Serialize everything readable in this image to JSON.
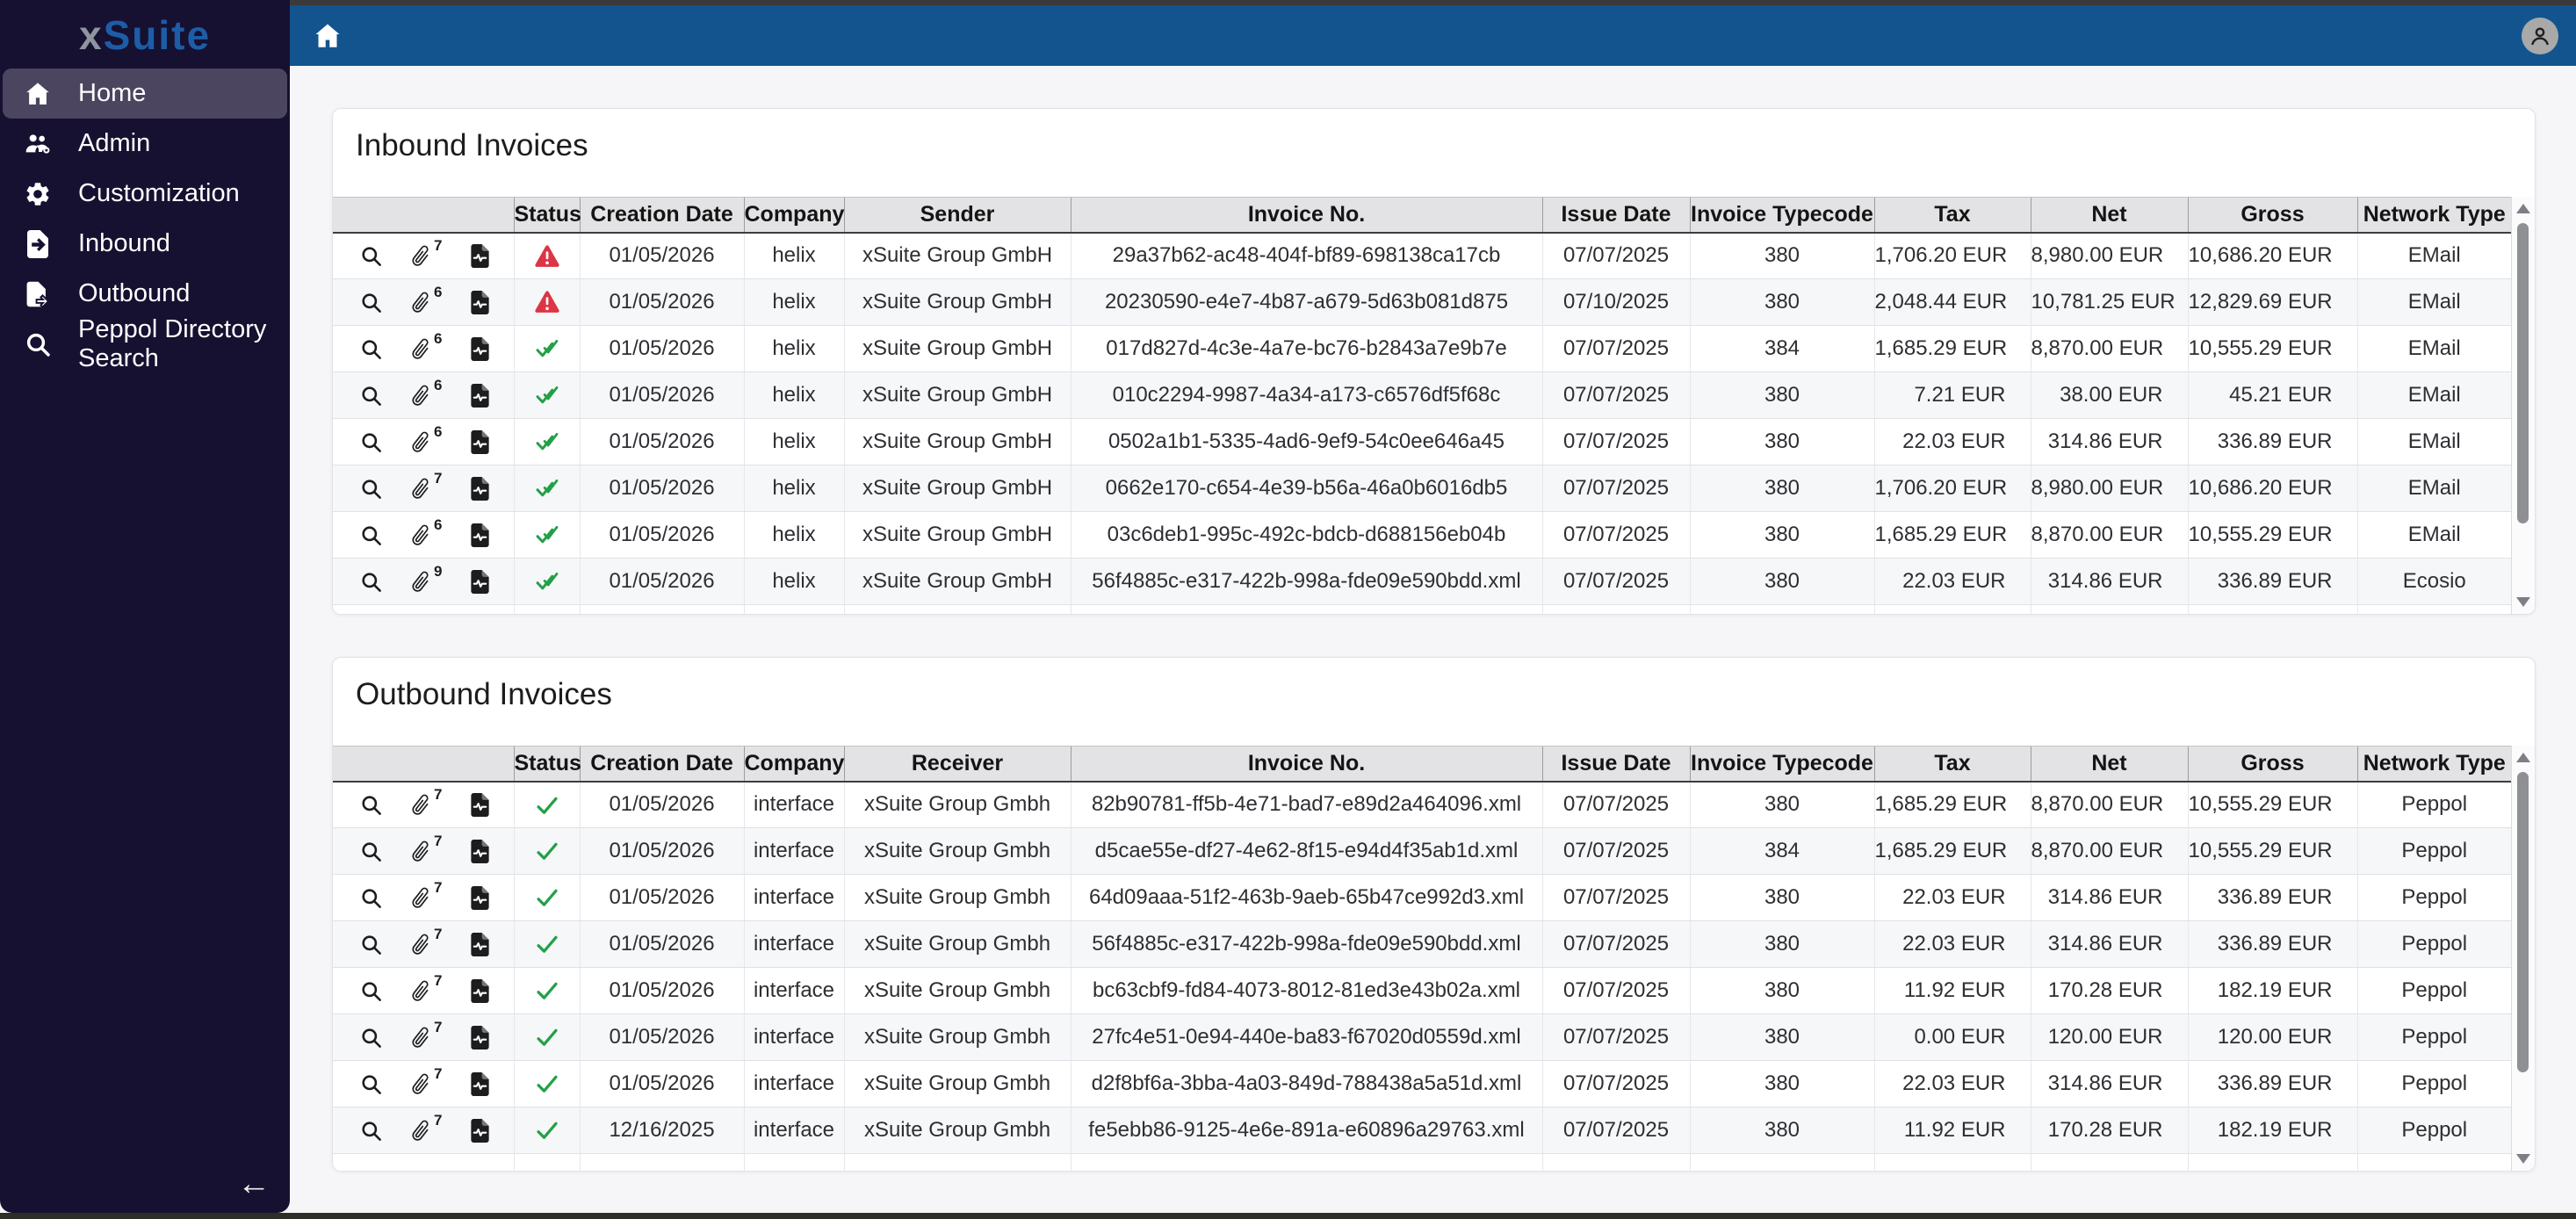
{
  "app": {
    "name": "xSuite"
  },
  "sidebar": {
    "logo": {
      "prefix": "x",
      "rest": "Suite"
    },
    "items": [
      {
        "label": "Home",
        "icon": "home-icon",
        "active": true
      },
      {
        "label": "Admin",
        "icon": "admin-users-icon",
        "active": false
      },
      {
        "label": "Customization",
        "icon": "gear-icon",
        "active": false
      },
      {
        "label": "Inbound",
        "icon": "inbound-document-icon",
        "active": false
      },
      {
        "label": "Outbound",
        "icon": "outbound-document-icon",
        "active": false
      },
      {
        "label": "Peppol Directory Search",
        "icon": "search-icon",
        "active": false
      }
    ],
    "collapse_arrow": "←"
  },
  "topbar": {
    "home_icon": "home-icon",
    "avatar_icon": "user-icon"
  },
  "icons": {
    "row_actions": [
      "search-icon",
      "paperclip-icon",
      "document-pulse-icon"
    ],
    "status": {
      "error": "warning-triangle-icon",
      "success": "check-icon",
      "success_double": "double-check-icon"
    }
  },
  "colors": {
    "topbar_blue": "#13548f",
    "sidebar_bg": "#161031",
    "sidebar_active": "#4b4560",
    "logo_gray": "#8e959e",
    "logo_blue": "#1d5da6",
    "success_green": "#23a047",
    "error_red": "#dc3545",
    "header_gray": "#e3e3e5"
  },
  "tables": {
    "inbound": {
      "title": "Inbound Invoices",
      "columns": [
        "",
        "Status",
        "Creation Date",
        "Company",
        "Sender",
        "Invoice No.",
        "Issue Date",
        "Invoice Typecode",
        "Tax",
        "Net",
        "Gross",
        "Network Type"
      ],
      "rows": [
        {
          "attachments": "7",
          "status": "error",
          "creation_date": "01/05/2026",
          "company": "helix",
          "party": "xSuite Group GmbH",
          "invoice_no": "29a37b62-ac48-404f-bf89-698138ca17cb",
          "issue_date": "07/07/2025",
          "typecode": "380",
          "tax": "1,706.20 EUR",
          "net": "8,980.00 EUR",
          "gross": "10,686.20 EUR",
          "network": "EMail"
        },
        {
          "attachments": "6",
          "status": "error",
          "creation_date": "01/05/2026",
          "company": "helix",
          "party": "xSuite Group GmbH",
          "invoice_no": "20230590-e4e7-4b87-a679-5d63b081d875",
          "issue_date": "07/10/2025",
          "typecode": "380",
          "tax": "2,048.44 EUR",
          "net": "10,781.25 EUR",
          "gross": "12,829.69 EUR",
          "network": "EMail"
        },
        {
          "attachments": "6",
          "status": "success_double",
          "creation_date": "01/05/2026",
          "company": "helix",
          "party": "xSuite Group GmbH",
          "invoice_no": "017d827d-4c3e-4a7e-bc76-b2843a7e9b7e",
          "issue_date": "07/07/2025",
          "typecode": "384",
          "tax": "1,685.29 EUR",
          "net": "8,870.00 EUR",
          "gross": "10,555.29 EUR",
          "network": "EMail"
        },
        {
          "attachments": "6",
          "status": "success_double",
          "creation_date": "01/05/2026",
          "company": "helix",
          "party": "xSuite Group GmbH",
          "invoice_no": "010c2294-9987-4a34-a173-c6576df5f68c",
          "issue_date": "07/07/2025",
          "typecode": "380",
          "tax": "7.21 EUR",
          "net": "38.00 EUR",
          "gross": "45.21 EUR",
          "network": "EMail"
        },
        {
          "attachments": "6",
          "status": "success_double",
          "creation_date": "01/05/2026",
          "company": "helix",
          "party": "xSuite Group GmbH",
          "invoice_no": "0502a1b1-5335-4ad6-9ef9-54c0ee646a45",
          "issue_date": "07/07/2025",
          "typecode": "380",
          "tax": "22.03 EUR",
          "net": "314.86 EUR",
          "gross": "336.89 EUR",
          "network": "EMail"
        },
        {
          "attachments": "7",
          "status": "success_double",
          "creation_date": "01/05/2026",
          "company": "helix",
          "party": "xSuite Group GmbH",
          "invoice_no": "0662e170-c654-4e39-b56a-46a0b6016db5",
          "issue_date": "07/07/2025",
          "typecode": "380",
          "tax": "1,706.20 EUR",
          "net": "8,980.00 EUR",
          "gross": "10,686.20 EUR",
          "network": "EMail"
        },
        {
          "attachments": "6",
          "status": "success_double",
          "creation_date": "01/05/2026",
          "company": "helix",
          "party": "xSuite Group GmbH",
          "invoice_no": "03c6deb1-995c-492c-bdcb-d688156eb04b",
          "issue_date": "07/07/2025",
          "typecode": "380",
          "tax": "1,685.29 EUR",
          "net": "8,870.00 EUR",
          "gross": "10,555.29 EUR",
          "network": "EMail"
        },
        {
          "attachments": "9",
          "status": "success_double",
          "creation_date": "01/05/2026",
          "company": "helix",
          "party": "xSuite Group GmbH",
          "invoice_no": "56f4885c-e317-422b-998a-fde09e590bdd.xml",
          "issue_date": "07/07/2025",
          "typecode": "380",
          "tax": "22.03 EUR",
          "net": "314.86 EUR",
          "gross": "336.89 EUR",
          "network": "Ecosio"
        }
      ]
    },
    "outbound": {
      "title": "Outbound Invoices",
      "columns": [
        "",
        "Status",
        "Creation Date",
        "Company",
        "Receiver",
        "Invoice No.",
        "Issue Date",
        "Invoice Typecode",
        "Tax",
        "Net",
        "Gross",
        "Network Type"
      ],
      "rows": [
        {
          "attachments": "7",
          "status": "success",
          "creation_date": "01/05/2026",
          "company": "interface",
          "party": "xSuite Group Gmbh",
          "invoice_no": "82b90781-ff5b-4e71-bad7-e89d2a464096.xml",
          "issue_date": "07/07/2025",
          "typecode": "380",
          "tax": "1,685.29 EUR",
          "net": "8,870.00 EUR",
          "gross": "10,555.29 EUR",
          "network": "Peppol"
        },
        {
          "attachments": "7",
          "status": "success",
          "creation_date": "01/05/2026",
          "company": "interface",
          "party": "xSuite Group Gmbh",
          "invoice_no": "d5cae55e-df27-4e62-8f15-e94d4f35ab1d.xml",
          "issue_date": "07/07/2025",
          "typecode": "384",
          "tax": "1,685.29 EUR",
          "net": "8,870.00 EUR",
          "gross": "10,555.29 EUR",
          "network": "Peppol"
        },
        {
          "attachments": "7",
          "status": "success",
          "creation_date": "01/05/2026",
          "company": "interface",
          "party": "xSuite Group Gmbh",
          "invoice_no": "64d09aaa-51f2-463b-9aeb-65b47ce992d3.xml",
          "issue_date": "07/07/2025",
          "typecode": "380",
          "tax": "22.03 EUR",
          "net": "314.86 EUR",
          "gross": "336.89 EUR",
          "network": "Peppol"
        },
        {
          "attachments": "7",
          "status": "success",
          "creation_date": "01/05/2026",
          "company": "interface",
          "party": "xSuite Group Gmbh",
          "invoice_no": "56f4885c-e317-422b-998a-fde09e590bdd.xml",
          "issue_date": "07/07/2025",
          "typecode": "380",
          "tax": "22.03 EUR",
          "net": "314.86 EUR",
          "gross": "336.89 EUR",
          "network": "Peppol"
        },
        {
          "attachments": "7",
          "status": "success",
          "creation_date": "01/05/2026",
          "company": "interface",
          "party": "xSuite Group Gmbh",
          "invoice_no": "bc63cbf9-fd84-4073-8012-81ed3e43b02a.xml",
          "issue_date": "07/07/2025",
          "typecode": "380",
          "tax": "11.92 EUR",
          "net": "170.28 EUR",
          "gross": "182.19 EUR",
          "network": "Peppol"
        },
        {
          "attachments": "7",
          "status": "success",
          "creation_date": "01/05/2026",
          "company": "interface",
          "party": "xSuite Group Gmbh",
          "invoice_no": "27fc4e51-0e94-440e-ba83-f67020d0559d.xml",
          "issue_date": "07/07/2025",
          "typecode": "380",
          "tax": "0.00 EUR",
          "net": "120.00 EUR",
          "gross": "120.00 EUR",
          "network": "Peppol"
        },
        {
          "attachments": "7",
          "status": "success",
          "creation_date": "01/05/2026",
          "company": "interface",
          "party": "xSuite Group Gmbh",
          "invoice_no": "d2f8bf6a-3bba-4a03-849d-788438a5a51d.xml",
          "issue_date": "07/07/2025",
          "typecode": "380",
          "tax": "22.03 EUR",
          "net": "314.86 EUR",
          "gross": "336.89 EUR",
          "network": "Peppol"
        },
        {
          "attachments": "7",
          "status": "success",
          "creation_date": "12/16/2025",
          "company": "interface",
          "party": "xSuite Group Gmbh",
          "invoice_no": "fe5ebb86-9125-4e6e-891a-e60896a29763.xml",
          "issue_date": "07/07/2025",
          "typecode": "380",
          "tax": "11.92 EUR",
          "net": "170.28 EUR",
          "gross": "182.19 EUR",
          "network": "Peppol"
        }
      ]
    }
  }
}
